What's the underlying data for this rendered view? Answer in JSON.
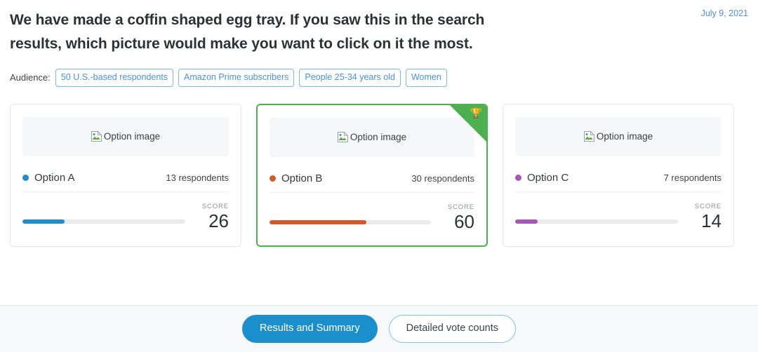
{
  "header": {
    "question": "We have made a coffin shaped egg tray. If you saw this in the search results, which picture would make you want to click on it the most.",
    "date": "July 9, 2021"
  },
  "audience": {
    "label": "Audience:",
    "tags": [
      "50 U.S.-based respondents",
      "Amazon Prime subscribers",
      "People 25-34 years old",
      "Women"
    ]
  },
  "options": [
    {
      "name": "Option A",
      "image_alt": "Option image",
      "respondents": "13 respondents",
      "score_label": "SCORE",
      "score": "26",
      "bar_percent": 26,
      "color": "#1a8fcc",
      "winner": false
    },
    {
      "name": "Option B",
      "image_alt": "Option image",
      "respondents": "30 respondents",
      "score_label": "SCORE",
      "score": "60",
      "bar_percent": 60,
      "color": "#d4582a",
      "winner": true,
      "winner_icon": "trophy-icon",
      "winner_glyph": "🏆"
    },
    {
      "name": "Option C",
      "image_alt": "Option image",
      "respondents": "7 respondents",
      "score_label": "SCORE",
      "score": "14",
      "bar_percent": 14,
      "color": "#a855b8",
      "winner": false
    }
  ],
  "footer": {
    "buttons": [
      {
        "label": "Results and Summary",
        "active": true
      },
      {
        "label": "Detailed vote counts",
        "active": false
      }
    ]
  },
  "colors": {
    "accent_blue": "#1a8fcc",
    "link_blue": "#4a90e2",
    "winner_green": "#4caf50",
    "option_a": "#1a8fcc",
    "option_b": "#d4582a",
    "option_c": "#a855b8",
    "track_gray": "#e8eaec",
    "footer_bg": "#f7f8fa"
  }
}
